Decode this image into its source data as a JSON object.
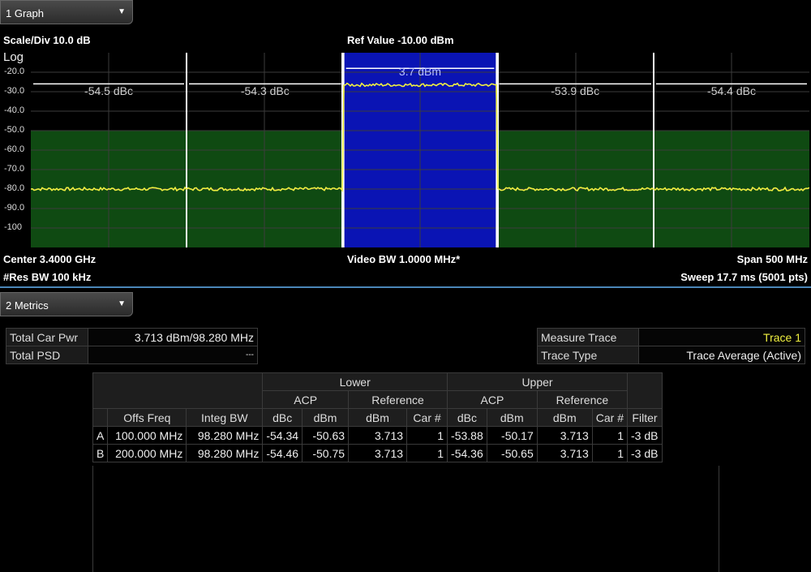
{
  "graph_tab": {
    "label": "1 Graph"
  },
  "graph_header": {
    "scale": "Scale/Div 10.0 dB",
    "ref": "Ref Value -10.00 dBm"
  },
  "graph_footer": {
    "center": "Center 3.4000 GHz",
    "video_bw": "Video BW 1.0000 MHz*",
    "span": "Span 500 MHz",
    "res_bw": "#Res BW 100 kHz",
    "sweep": "Sweep 17.7 ms  (5001 pts)"
  },
  "y_axis": {
    "scale_label": "Log",
    "ticks": [
      "-20.0",
      "-30.0",
      "-40.0",
      "-50.0",
      "-60.0",
      "-70.0",
      "-80.0",
      "-90.0",
      "-100"
    ]
  },
  "annotations": {
    "carrier": "3.7 dBm",
    "offsets": [
      "-54.5 dBc",
      "-54.3 dBc",
      "-53.9 dBc",
      "-54.4 dBc"
    ]
  },
  "colors": {
    "trace": "#f0f040",
    "carrier_fill": "#0a14b4",
    "limit_fill": "#0f4a12",
    "grid": "#3c3c3c",
    "divider": "#4a86b8"
  },
  "chart_data": {
    "type": "line",
    "y_range_dbm": [
      -10,
      -110
    ],
    "x_span_mhz": [
      -250,
      250
    ],
    "limit_level_dbm": -50.0,
    "noise_floor_dbm": -80.0,
    "carrier_level_dbm": -26.5,
    "carrier_band_mhz": [
      -49.14,
      49.14
    ],
    "offset_bands_mhz": [
      [
        -250,
        -150
      ],
      [
        -150,
        -50
      ],
      [
        50,
        150
      ],
      [
        150,
        250
      ]
    ]
  },
  "metrics_tab": {
    "label": "2 Metrics"
  },
  "summary": {
    "total_car_pwr_label": "Total Car Pwr",
    "total_car_pwr_value": "3.713 dBm/98.280 MHz",
    "total_psd_label": "Total PSD",
    "total_psd_value": "---"
  },
  "trace_info": {
    "measure_trace_label": "Measure Trace",
    "measure_trace_value": "Trace 1",
    "trace_type_label": "Trace Type",
    "trace_type_value": "Trace Average (Active)"
  },
  "acp_table": {
    "lower": "Lower",
    "upper": "Upper",
    "acp": "ACP",
    "reference": "Reference",
    "columns": [
      "Offs Freq",
      "Integ BW",
      "dBc",
      "dBm",
      "dBm",
      "Car #",
      "dBc",
      "dBm",
      "dBm",
      "Car #",
      "Filter"
    ],
    "rows": [
      [
        "A",
        "100.000 MHz",
        "98.280 MHz",
        "-54.34",
        "-50.63",
        "3.713",
        "1",
        "-53.88",
        "-50.17",
        "3.713",
        "1",
        "-3 dB"
      ],
      [
        "B",
        "200.000 MHz",
        "98.280 MHz",
        "-54.46",
        "-50.75",
        "3.713",
        "1",
        "-54.36",
        "-50.65",
        "3.713",
        "1",
        "-3 dB"
      ]
    ]
  }
}
